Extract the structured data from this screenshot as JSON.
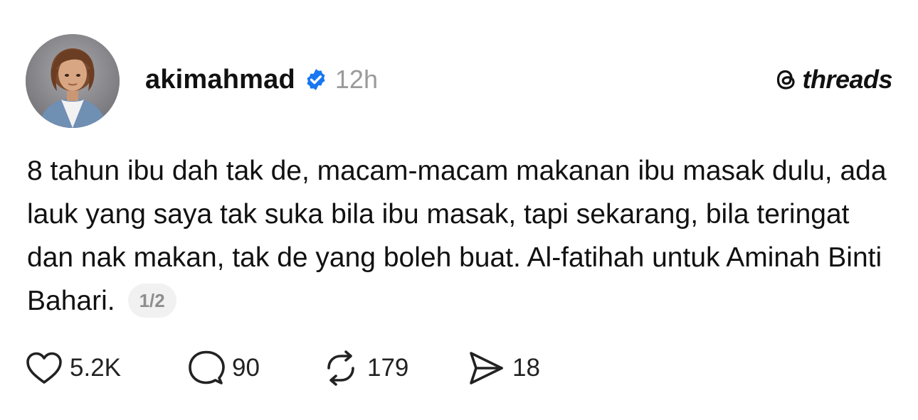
{
  "post": {
    "username": "akimahmad",
    "timestamp": "12h",
    "verified": true,
    "verified_color": "#1877f2",
    "brand_name": "threads",
    "body": "8 tahun ibu dah tak de, macam-macam makanan ibu masak dulu, ada lauk yang saya tak suka bila ibu masak, tapi sekarang, bila teringat dan nak makan, tak de yang boleh buat. Al-fatihah untuk Aminah Binti Bahari.",
    "pager": "1/2"
  },
  "actions": {
    "likes": "5.2K",
    "comments": "90",
    "reposts": "179",
    "shares": "18"
  },
  "icons": {
    "verified": "verified-badge-icon",
    "brand": "threads-logo-icon",
    "like": "heart-icon",
    "comment": "comment-bubble-icon",
    "repost": "repost-arrows-icon",
    "share": "send-icon"
  }
}
